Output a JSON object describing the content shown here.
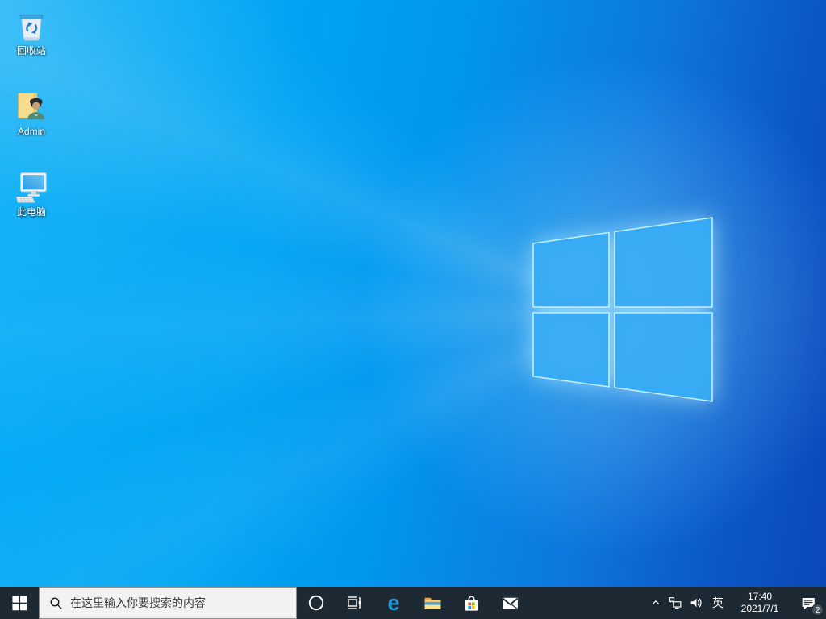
{
  "desktop": {
    "icons": [
      {
        "label": "回收站",
        "icon": "recycle-bin-icon"
      },
      {
        "label": "Admin",
        "icon": "user-folder-icon"
      },
      {
        "label": "此电脑",
        "icon": "this-pc-icon"
      }
    ],
    "wallpaper": "windows-10-light-logo"
  },
  "taskbar": {
    "start": {
      "icon": "windows-logo-icon"
    },
    "search": {
      "placeholder": "在这里输入你要搜索的内容",
      "icon": "search-icon"
    },
    "apps": [
      {
        "name": "cortana",
        "icon": "cortana-icon"
      },
      {
        "name": "task-view",
        "icon": "task-view-icon"
      },
      {
        "name": "edge",
        "icon": "edge-icon"
      },
      {
        "name": "file-explorer",
        "icon": "file-explorer-icon"
      },
      {
        "name": "microsoft-store",
        "icon": "store-icon"
      },
      {
        "name": "mail",
        "icon": "mail-icon"
      }
    ],
    "tray": {
      "icons": [
        {
          "name": "hidden-icons",
          "icon": "chevron-up-icon"
        },
        {
          "name": "network",
          "icon": "network-icon"
        },
        {
          "name": "volume",
          "icon": "volume-icon"
        }
      ],
      "language": "英",
      "time": "17:40",
      "date": "2021/7/1",
      "notification_badge": "2"
    }
  },
  "colors": {
    "taskbar_bg": "#1d2a34",
    "search_bg": "#f3f2f1",
    "badge_bg": "#46535c",
    "wallpaper_left": "#00a8f4",
    "wallpaper_right": "#0946b6",
    "logo_pane": "#37aaf4",
    "logo_edge": "#bff0fd",
    "edge_blue": "#2398dd"
  }
}
